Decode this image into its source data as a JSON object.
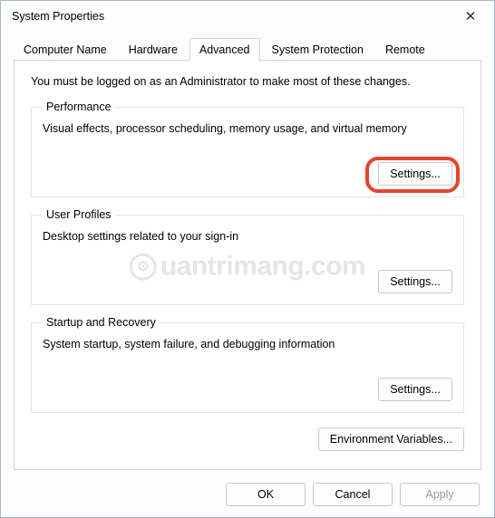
{
  "title": "System Properties",
  "tabs": [
    "Computer Name",
    "Hardware",
    "Advanced",
    "System Protection",
    "Remote"
  ],
  "activeTab": 2,
  "intro": "You must be logged on as an Administrator to make most of these changes.",
  "groups": {
    "performance": {
      "legend": "Performance",
      "desc": "Visual effects, processor scheduling, memory usage, and virtual memory",
      "button": "Settings..."
    },
    "userProfiles": {
      "legend": "User Profiles",
      "desc": "Desktop settings related to your sign-in",
      "button": "Settings..."
    },
    "startup": {
      "legend": "Startup and Recovery",
      "desc": "System startup, system failure, and debugging information",
      "button": "Settings..."
    }
  },
  "envButton": "Environment Variables...",
  "footer": {
    "ok": "OK",
    "cancel": "Cancel",
    "apply": "Apply"
  },
  "watermark": "uantrimang.com"
}
